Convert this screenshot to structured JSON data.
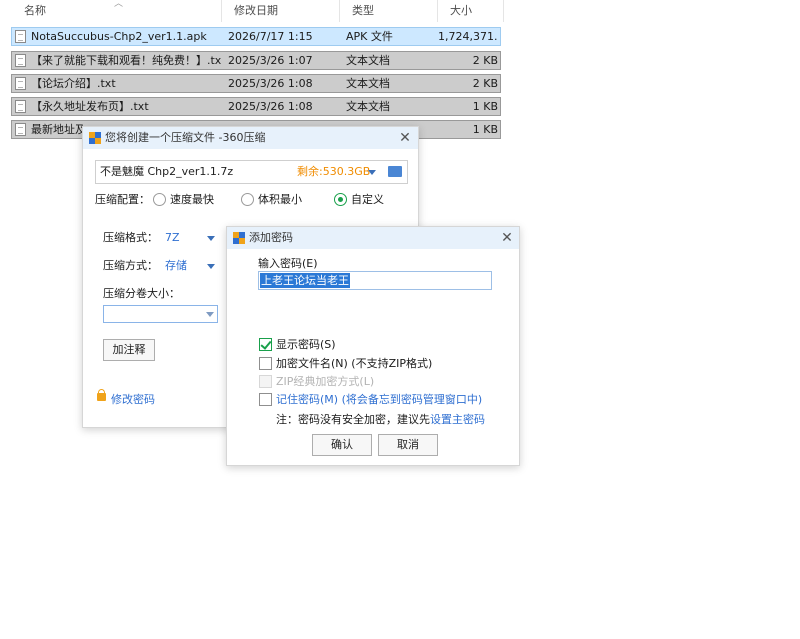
{
  "explorer": {
    "columns": {
      "name": "名称",
      "modified": "修改日期",
      "type": "类型",
      "size": "大小"
    },
    "files": [
      {
        "name": "NotaSuccubus-Chp2_ver1.1.apk",
        "modified": "2026/7/17 1:15",
        "type": "APK 文件",
        "size": "1,724,371..."
      },
      {
        "name": "【来了就能下载和观看！纯免费！】.txt",
        "modified": "2025/3/26 1:07",
        "type": "文本文档",
        "size": "2 KB"
      },
      {
        "name": "【论坛介绍】.txt",
        "modified": "2025/3/26 1:08",
        "type": "文本文档",
        "size": "2 KB"
      },
      {
        "name": "【永久地址发布页】.txt",
        "modified": "2025/3/26 1:08",
        "type": "文本文档",
        "size": "1 KB"
      },
      {
        "name": "最新地址及...",
        "modified": "",
        "type": "",
        "size": "1 KB"
      }
    ]
  },
  "compress_dialog": {
    "title": "您将创建一个压缩文件 -360压缩",
    "close_glyph": "✕",
    "filename": "不是魅魔  Chp2_ver1.1.7z",
    "free_space": "剩余:530.3GB",
    "config_label": "压缩配置：",
    "options": [
      "速度最快",
      "体积最小",
      "自定义"
    ],
    "selected_option": "自定义",
    "format_label": "压缩格式：",
    "format_value": "7Z",
    "method_label": "压缩方式：",
    "method_value": "存储",
    "split_label": "压缩分卷大小：",
    "split_value": "",
    "comment_button": "加注释",
    "change_password": "修改密码",
    "colors": {
      "accent": "#2f6fd1",
      "free_space": "#f08c00",
      "radio_on": "#19a04b"
    }
  },
  "password_dialog": {
    "title": "添加密码",
    "close_glyph": "✕",
    "input_label": "输入密码(E)",
    "password_value": "上老王论坛当老王",
    "show_password": {
      "label": "显示密码(S)",
      "checked": true
    },
    "encrypt_names": {
      "label": "加密文件名(N) (不支持ZIP格式)",
      "checked": false
    },
    "zip_classic": {
      "label": "ZIP经典加密方式(L)",
      "checked": false,
      "disabled": true
    },
    "remember": {
      "label": "记住密码(M) (将会备忘到密码管理窗口中)",
      "checked": false
    },
    "note_prefix": "注：密码没有安全加密，建议先",
    "note_link": "设置主密码",
    "ok_button": "确认",
    "cancel_button": "取消"
  }
}
